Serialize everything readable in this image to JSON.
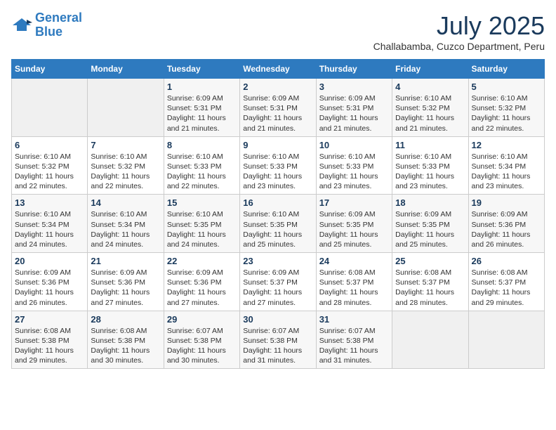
{
  "header": {
    "logo_line1": "General",
    "logo_line2": "Blue",
    "month": "July 2025",
    "location": "Challabamba, Cuzco Department, Peru"
  },
  "weekdays": [
    "Sunday",
    "Monday",
    "Tuesday",
    "Wednesday",
    "Thursday",
    "Friday",
    "Saturday"
  ],
  "weeks": [
    [
      {
        "day": "",
        "sunrise": "",
        "sunset": "",
        "daylight": ""
      },
      {
        "day": "",
        "sunrise": "",
        "sunset": "",
        "daylight": ""
      },
      {
        "day": "1",
        "sunrise": "Sunrise: 6:09 AM",
        "sunset": "Sunset: 5:31 PM",
        "daylight": "Daylight: 11 hours and 21 minutes."
      },
      {
        "day": "2",
        "sunrise": "Sunrise: 6:09 AM",
        "sunset": "Sunset: 5:31 PM",
        "daylight": "Daylight: 11 hours and 21 minutes."
      },
      {
        "day": "3",
        "sunrise": "Sunrise: 6:09 AM",
        "sunset": "Sunset: 5:31 PM",
        "daylight": "Daylight: 11 hours and 21 minutes."
      },
      {
        "day": "4",
        "sunrise": "Sunrise: 6:10 AM",
        "sunset": "Sunset: 5:32 PM",
        "daylight": "Daylight: 11 hours and 21 minutes."
      },
      {
        "day": "5",
        "sunrise": "Sunrise: 6:10 AM",
        "sunset": "Sunset: 5:32 PM",
        "daylight": "Daylight: 11 hours and 22 minutes."
      }
    ],
    [
      {
        "day": "6",
        "sunrise": "Sunrise: 6:10 AM",
        "sunset": "Sunset: 5:32 PM",
        "daylight": "Daylight: 11 hours and 22 minutes."
      },
      {
        "day": "7",
        "sunrise": "Sunrise: 6:10 AM",
        "sunset": "Sunset: 5:32 PM",
        "daylight": "Daylight: 11 hours and 22 minutes."
      },
      {
        "day": "8",
        "sunrise": "Sunrise: 6:10 AM",
        "sunset": "Sunset: 5:33 PM",
        "daylight": "Daylight: 11 hours and 22 minutes."
      },
      {
        "day": "9",
        "sunrise": "Sunrise: 6:10 AM",
        "sunset": "Sunset: 5:33 PM",
        "daylight": "Daylight: 11 hours and 23 minutes."
      },
      {
        "day": "10",
        "sunrise": "Sunrise: 6:10 AM",
        "sunset": "Sunset: 5:33 PM",
        "daylight": "Daylight: 11 hours and 23 minutes."
      },
      {
        "day": "11",
        "sunrise": "Sunrise: 6:10 AM",
        "sunset": "Sunset: 5:33 PM",
        "daylight": "Daylight: 11 hours and 23 minutes."
      },
      {
        "day": "12",
        "sunrise": "Sunrise: 6:10 AM",
        "sunset": "Sunset: 5:34 PM",
        "daylight": "Daylight: 11 hours and 23 minutes."
      }
    ],
    [
      {
        "day": "13",
        "sunrise": "Sunrise: 6:10 AM",
        "sunset": "Sunset: 5:34 PM",
        "daylight": "Daylight: 11 hours and 24 minutes."
      },
      {
        "day": "14",
        "sunrise": "Sunrise: 6:10 AM",
        "sunset": "Sunset: 5:34 PM",
        "daylight": "Daylight: 11 hours and 24 minutes."
      },
      {
        "day": "15",
        "sunrise": "Sunrise: 6:10 AM",
        "sunset": "Sunset: 5:35 PM",
        "daylight": "Daylight: 11 hours and 24 minutes."
      },
      {
        "day": "16",
        "sunrise": "Sunrise: 6:10 AM",
        "sunset": "Sunset: 5:35 PM",
        "daylight": "Daylight: 11 hours and 25 minutes."
      },
      {
        "day": "17",
        "sunrise": "Sunrise: 6:09 AM",
        "sunset": "Sunset: 5:35 PM",
        "daylight": "Daylight: 11 hours and 25 minutes."
      },
      {
        "day": "18",
        "sunrise": "Sunrise: 6:09 AM",
        "sunset": "Sunset: 5:35 PM",
        "daylight": "Daylight: 11 hours and 25 minutes."
      },
      {
        "day": "19",
        "sunrise": "Sunrise: 6:09 AM",
        "sunset": "Sunset: 5:36 PM",
        "daylight": "Daylight: 11 hours and 26 minutes."
      }
    ],
    [
      {
        "day": "20",
        "sunrise": "Sunrise: 6:09 AM",
        "sunset": "Sunset: 5:36 PM",
        "daylight": "Daylight: 11 hours and 26 minutes."
      },
      {
        "day": "21",
        "sunrise": "Sunrise: 6:09 AM",
        "sunset": "Sunset: 5:36 PM",
        "daylight": "Daylight: 11 hours and 27 minutes."
      },
      {
        "day": "22",
        "sunrise": "Sunrise: 6:09 AM",
        "sunset": "Sunset: 5:36 PM",
        "daylight": "Daylight: 11 hours and 27 minutes."
      },
      {
        "day": "23",
        "sunrise": "Sunrise: 6:09 AM",
        "sunset": "Sunset: 5:37 PM",
        "daylight": "Daylight: 11 hours and 27 minutes."
      },
      {
        "day": "24",
        "sunrise": "Sunrise: 6:08 AM",
        "sunset": "Sunset: 5:37 PM",
        "daylight": "Daylight: 11 hours and 28 minutes."
      },
      {
        "day": "25",
        "sunrise": "Sunrise: 6:08 AM",
        "sunset": "Sunset: 5:37 PM",
        "daylight": "Daylight: 11 hours and 28 minutes."
      },
      {
        "day": "26",
        "sunrise": "Sunrise: 6:08 AM",
        "sunset": "Sunset: 5:37 PM",
        "daylight": "Daylight: 11 hours and 29 minutes."
      }
    ],
    [
      {
        "day": "27",
        "sunrise": "Sunrise: 6:08 AM",
        "sunset": "Sunset: 5:38 PM",
        "daylight": "Daylight: 11 hours and 29 minutes."
      },
      {
        "day": "28",
        "sunrise": "Sunrise: 6:08 AM",
        "sunset": "Sunset: 5:38 PM",
        "daylight": "Daylight: 11 hours and 30 minutes."
      },
      {
        "day": "29",
        "sunrise": "Sunrise: 6:07 AM",
        "sunset": "Sunset: 5:38 PM",
        "daylight": "Daylight: 11 hours and 30 minutes."
      },
      {
        "day": "30",
        "sunrise": "Sunrise: 6:07 AM",
        "sunset": "Sunset: 5:38 PM",
        "daylight": "Daylight: 11 hours and 31 minutes."
      },
      {
        "day": "31",
        "sunrise": "Sunrise: 6:07 AM",
        "sunset": "Sunset: 5:38 PM",
        "daylight": "Daylight: 11 hours and 31 minutes."
      },
      {
        "day": "",
        "sunrise": "",
        "sunset": "",
        "daylight": ""
      },
      {
        "day": "",
        "sunrise": "",
        "sunset": "",
        "daylight": ""
      }
    ]
  ]
}
